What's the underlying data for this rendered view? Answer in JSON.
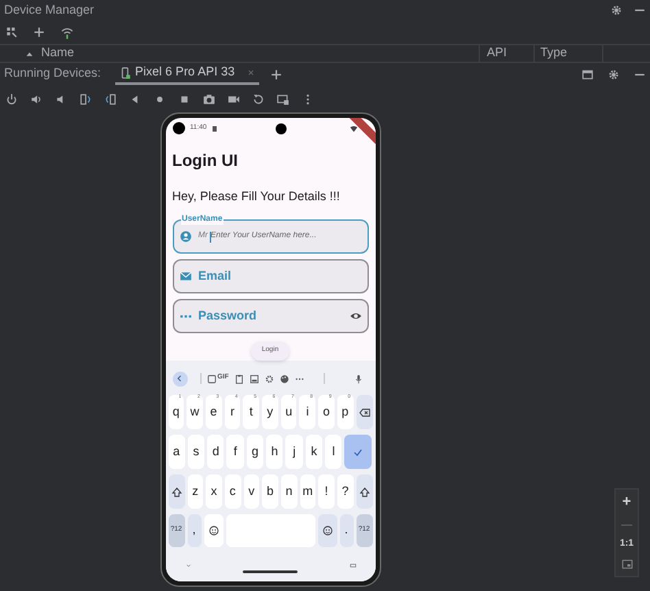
{
  "window": {
    "title": "Device Manager"
  },
  "device_table": {
    "columns": [
      "Name",
      "API",
      "Type"
    ]
  },
  "running_devices": {
    "label": "Running Devices:",
    "tabs": [
      {
        "label": "Pixel 6 Pro API 33",
        "selected": true
      }
    ]
  },
  "phone": {
    "status_time": "11:40",
    "app_title": "Login UI",
    "greeting": "Hey, Please Fill Your Details !!!",
    "fields": [
      {
        "kind": "text",
        "label": "UserName",
        "prefix": "Mr",
        "placeholder": "Enter Your UserName here...",
        "focused": true
      },
      {
        "kind": "email",
        "label": "Email",
        "focused": false
      },
      {
        "kind": "password",
        "label": "Password",
        "focused": false
      }
    ],
    "login_button": "Login",
    "keyboard": {
      "toolbar_gif": "GIF",
      "key_rows": [
        {
          "keys": [
            {
              "kind": "char",
              "label": "q",
              "hint": "1"
            },
            {
              "kind": "char",
              "label": "w",
              "hint": "2"
            },
            {
              "kind": "char",
              "label": "e",
              "hint": "3"
            },
            {
              "kind": "char",
              "label": "r",
              "hint": "4"
            },
            {
              "kind": "char",
              "label": "t",
              "hint": "5"
            },
            {
              "kind": "char",
              "label": "y",
              "hint": "6"
            },
            {
              "kind": "char",
              "label": "u",
              "hint": "7"
            },
            {
              "kind": "char",
              "label": "i",
              "hint": "8"
            },
            {
              "kind": "char",
              "label": "o",
              "hint": "9"
            },
            {
              "kind": "char",
              "label": "p",
              "hint": "0"
            },
            {
              "kind": "backspace"
            }
          ]
        },
        {
          "keys": [
            {
              "kind": "char",
              "label": "a"
            },
            {
              "kind": "char",
              "label": "s"
            },
            {
              "kind": "char",
              "label": "d"
            },
            {
              "kind": "char",
              "label": "f"
            },
            {
              "kind": "char",
              "label": "g"
            },
            {
              "kind": "char",
              "label": "h"
            },
            {
              "kind": "char",
              "label": "j"
            },
            {
              "kind": "char",
              "label": "k"
            },
            {
              "kind": "char",
              "label": "l"
            },
            {
              "kind": "enter"
            }
          ]
        },
        {
          "keys": [
            {
              "kind": "shift"
            },
            {
              "kind": "char",
              "label": "z"
            },
            {
              "kind": "char",
              "label": "x"
            },
            {
              "kind": "char",
              "label": "c"
            },
            {
              "kind": "char",
              "label": "v"
            },
            {
              "kind": "char",
              "label": "b"
            },
            {
              "kind": "char",
              "label": "n"
            },
            {
              "kind": "char",
              "label": "m"
            },
            {
              "kind": "char",
              "label": "!"
            },
            {
              "kind": "char",
              "label": "?"
            },
            {
              "kind": "shift"
            }
          ]
        },
        {
          "keys": [
            {
              "kind": "symbols",
              "label": "?12"
            },
            {
              "kind": "mod",
              "label": ","
            },
            {
              "kind": "emoji"
            },
            {
              "kind": "space"
            },
            {
              "kind": "emoji"
            },
            {
              "kind": "mod",
              "label": "."
            },
            {
              "kind": "symbols",
              "label": "?12"
            }
          ]
        }
      ]
    }
  },
  "zoom_controls": {
    "plus": "+",
    "minus": "—",
    "actual_size": "1:1"
  }
}
